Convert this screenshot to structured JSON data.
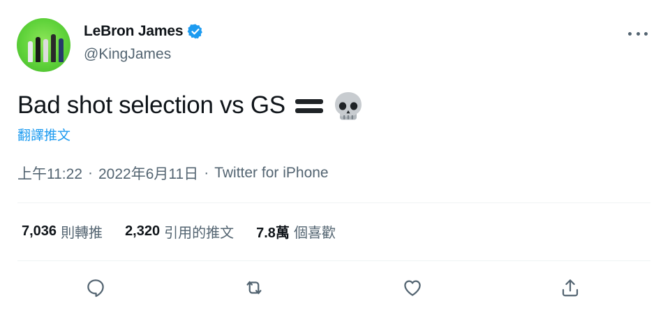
{
  "author": {
    "display_name": "LeBron James",
    "handle": "@KingJames",
    "verified": true,
    "avatar_bg": "#5fd23a"
  },
  "menu_icon": "more-dots-icon",
  "tweet": {
    "text": "Bad shot selection vs GS",
    "emojis": [
      "heavy-equals-sign",
      "skull"
    ],
    "translate_label": "翻譯推文"
  },
  "meta": {
    "time": "上午11:22",
    "separator": "·",
    "date": "2022年6月11日",
    "source": "Twitter for iPhone"
  },
  "stats": [
    {
      "value": "7,036",
      "label": "則轉推"
    },
    {
      "value": "2,320",
      "label": "引用的推文"
    },
    {
      "value": "7.8萬",
      "label": "個喜歡"
    }
  ],
  "actions": [
    "reply-icon",
    "retweet-icon",
    "like-icon",
    "share-icon"
  ],
  "colors": {
    "link": "#1d9bf0",
    "secondary_text": "#536471",
    "primary_text": "#0f1419",
    "divider": "#eff3f4"
  }
}
